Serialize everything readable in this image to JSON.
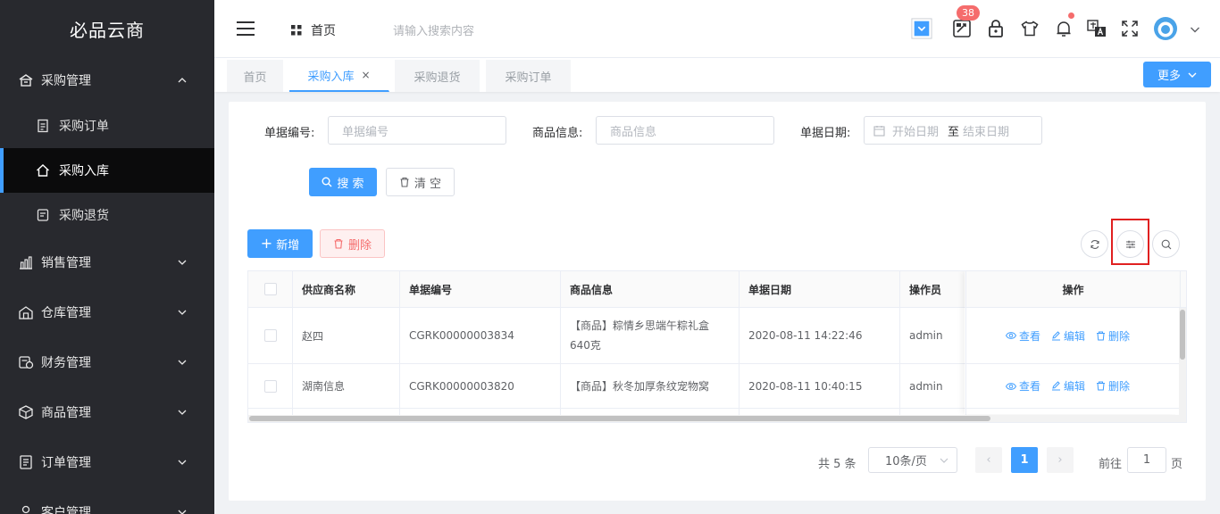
{
  "app": {
    "name": "必品云商"
  },
  "sidebar": {
    "groups": [
      {
        "label": "采购管理",
        "icon": "purchase-icon",
        "expanded": true,
        "children": [
          {
            "label": "采购订单",
            "icon": "document-icon"
          },
          {
            "label": "采购入库",
            "icon": "home-icon",
            "active": true
          },
          {
            "label": "采购退货",
            "icon": "return-icon"
          }
        ]
      },
      {
        "label": "销售管理",
        "icon": "sales-chart-icon"
      },
      {
        "label": "仓库管理",
        "icon": "warehouse-icon"
      },
      {
        "label": "财务管理",
        "icon": "finance-icon"
      },
      {
        "label": "商品管理",
        "icon": "box-icon"
      },
      {
        "label": "订单管理",
        "icon": "order-icon"
      },
      {
        "label": "客户管理",
        "icon": "customer-icon"
      }
    ]
  },
  "header": {
    "breadcrumb": "首页",
    "search_placeholder": "请输入搜索内容",
    "notification_count": "38",
    "tools": [
      "dropdown-toggle-icon",
      "task-icon",
      "lock-icon",
      "theme-shirt-icon",
      "bell-icon",
      "translate-icon",
      "fullscreen-icon",
      "avatar"
    ]
  },
  "tabs": {
    "items": [
      "首页",
      "采购入库",
      "采购退货",
      "采购订单"
    ],
    "active_index": 1,
    "close_glyph": "×",
    "more_label": "更多"
  },
  "filters": {
    "doc_no_label": "单据编号:",
    "doc_no_placeholder": "单据编号",
    "goods_label": "商品信息:",
    "goods_placeholder": "商品信息",
    "date_label": "单据日期:",
    "date_start_placeholder": "开始日期",
    "date_separator": "至",
    "date_end_placeholder": "结束日期",
    "search_button": "搜 索",
    "clear_button": "清 空"
  },
  "toolbar": {
    "add_button": "新增",
    "delete_button": "删除"
  },
  "table": {
    "columns": [
      "供应商名称",
      "单据编号",
      "商品信息",
      "单据日期",
      "操作员",
      "操作"
    ],
    "rows": [
      {
        "supplier": "赵四",
        "doc_no": "CGRK00000003834",
        "goods": "【商品】粽情乡思端午粽礼盒 640克",
        "date": "2020-08-11 14:22:46",
        "operator": "admin"
      },
      {
        "supplier": "湖南信息",
        "doc_no": "CGRK00000003820",
        "goods": "【商品】秋冬加厚条纹宠物窝",
        "date": "2020-08-11 10:40:15",
        "operator": "admin"
      }
    ],
    "actions": {
      "view": "查看",
      "edit": "编辑",
      "delete": "删除"
    }
  },
  "pagination": {
    "total_text": "共 5 条",
    "page_size": "10条/页",
    "current_page": "1",
    "prev_glyph": "‹",
    "next_glyph": "›",
    "goto_label": "前往",
    "goto_value": "1",
    "page_unit": "页"
  },
  "colors": {
    "primary": "#409eff",
    "danger": "#f56c6c",
    "sidebar_bg": "#28292e",
    "highlight": "#e02020"
  }
}
